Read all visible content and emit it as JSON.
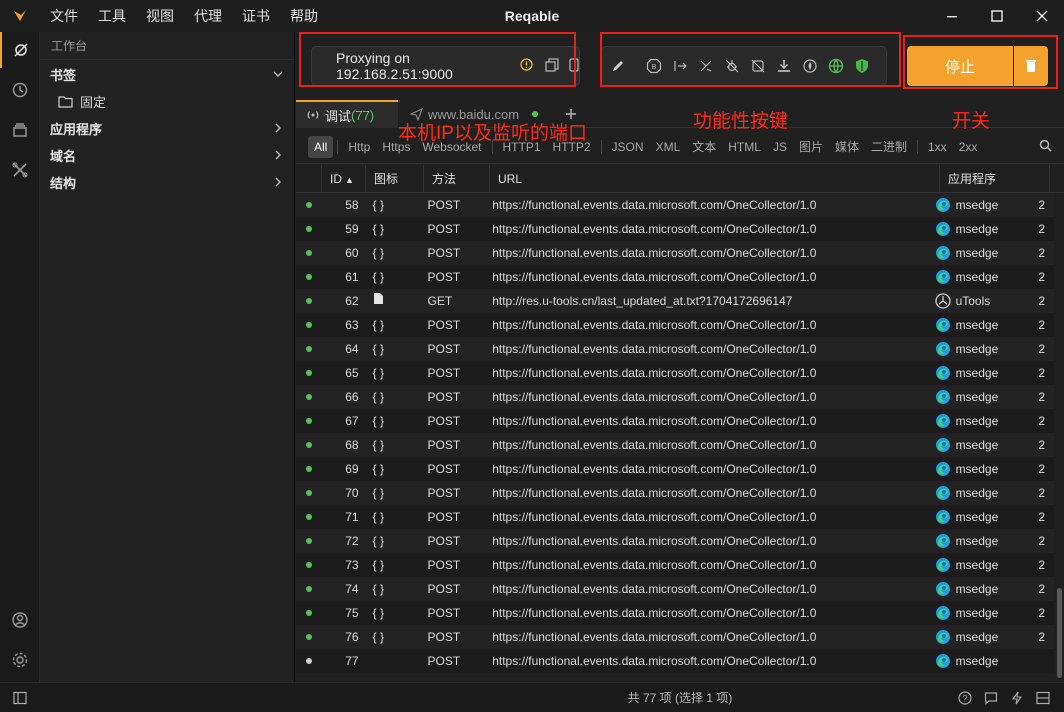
{
  "titlebar": {
    "title": "Reqable",
    "menus": [
      "文件",
      "工具",
      "视图",
      "代理",
      "证书",
      "帮助"
    ]
  },
  "sidebar": {
    "header": "工作台",
    "bookmarks": "书签",
    "pinned": "固定",
    "apps": "应用程序",
    "domains": "域名",
    "structure": "结构"
  },
  "toolbar": {
    "proxy_text": "Proxying on 192.168.2.51:9000",
    "stop_label": "停止"
  },
  "annotations": {
    "ip_port": "本机IP以及监听的端口",
    "function_keys": "功能性按键",
    "switch": "开关"
  },
  "tabs": [
    {
      "label": "调试",
      "count": "(77)"
    },
    {
      "label": "www.baidu.com"
    }
  ],
  "filters": [
    "All",
    "Http",
    "Https",
    "Websocket",
    "HTTP1",
    "HTTP2",
    "JSON",
    "XML",
    "文本",
    "HTML",
    "JS",
    "图片",
    "媒体",
    "二进制",
    "1xx",
    "2xx"
  ],
  "table": {
    "headers": {
      "id": "ID",
      "icon": "图标",
      "method": "方法",
      "url": "URL",
      "app": "应用程序"
    },
    "rows": [
      {
        "id": "58",
        "icon": "{ }",
        "method": "POST",
        "url": "https://functional.events.data.microsoft.com/OneCollector/1.0",
        "app": "msedge",
        "status": "done",
        "more": "2"
      },
      {
        "id": "59",
        "icon": "{ }",
        "method": "POST",
        "url": "https://functional.events.data.microsoft.com/OneCollector/1.0",
        "app": "msedge",
        "status": "done",
        "more": "2"
      },
      {
        "id": "60",
        "icon": "{ }",
        "method": "POST",
        "url": "https://functional.events.data.microsoft.com/OneCollector/1.0",
        "app": "msedge",
        "status": "done",
        "more": "2"
      },
      {
        "id": "61",
        "icon": "{ }",
        "method": "POST",
        "url": "https://functional.events.data.microsoft.com/OneCollector/1.0",
        "app": "msedge",
        "status": "done",
        "more": "2"
      },
      {
        "id": "62",
        "icon": "file",
        "method": "GET",
        "url": "http://res.u-tools.cn/last_updated_at.txt?1704172696147",
        "app": "uTools",
        "status": "done",
        "more": "2"
      },
      {
        "id": "63",
        "icon": "{ }",
        "method": "POST",
        "url": "https://functional.events.data.microsoft.com/OneCollector/1.0",
        "app": "msedge",
        "status": "done",
        "more": "2"
      },
      {
        "id": "64",
        "icon": "{ }",
        "method": "POST",
        "url": "https://functional.events.data.microsoft.com/OneCollector/1.0",
        "app": "msedge",
        "status": "done",
        "more": "2"
      },
      {
        "id": "65",
        "icon": "{ }",
        "method": "POST",
        "url": "https://functional.events.data.microsoft.com/OneCollector/1.0",
        "app": "msedge",
        "status": "done",
        "more": "2"
      },
      {
        "id": "66",
        "icon": "{ }",
        "method": "POST",
        "url": "https://functional.events.data.microsoft.com/OneCollector/1.0",
        "app": "msedge",
        "status": "done",
        "more": "2"
      },
      {
        "id": "67",
        "icon": "{ }",
        "method": "POST",
        "url": "https://functional.events.data.microsoft.com/OneCollector/1.0",
        "app": "msedge",
        "status": "done",
        "more": "2"
      },
      {
        "id": "68",
        "icon": "{ }",
        "method": "POST",
        "url": "https://functional.events.data.microsoft.com/OneCollector/1.0",
        "app": "msedge",
        "status": "done",
        "more": "2"
      },
      {
        "id": "69",
        "icon": "{ }",
        "method": "POST",
        "url": "https://functional.events.data.microsoft.com/OneCollector/1.0",
        "app": "msedge",
        "status": "done",
        "more": "2"
      },
      {
        "id": "70",
        "icon": "{ }",
        "method": "POST",
        "url": "https://functional.events.data.microsoft.com/OneCollector/1.0",
        "app": "msedge",
        "status": "done",
        "more": "2"
      },
      {
        "id": "71",
        "icon": "{ }",
        "method": "POST",
        "url": "https://functional.events.data.microsoft.com/OneCollector/1.0",
        "app": "msedge",
        "status": "done",
        "more": "2"
      },
      {
        "id": "72",
        "icon": "{ }",
        "method": "POST",
        "url": "https://functional.events.data.microsoft.com/OneCollector/1.0",
        "app": "msedge",
        "status": "done",
        "more": "2"
      },
      {
        "id": "73",
        "icon": "{ }",
        "method": "POST",
        "url": "https://functional.events.data.microsoft.com/OneCollector/1.0",
        "app": "msedge",
        "status": "done",
        "more": "2"
      },
      {
        "id": "74",
        "icon": "{ }",
        "method": "POST",
        "url": "https://functional.events.data.microsoft.com/OneCollector/1.0",
        "app": "msedge",
        "status": "done",
        "more": "2"
      },
      {
        "id": "75",
        "icon": "{ }",
        "method": "POST",
        "url": "https://functional.events.data.microsoft.com/OneCollector/1.0",
        "app": "msedge",
        "status": "done",
        "more": "2"
      },
      {
        "id": "76",
        "icon": "{ }",
        "method": "POST",
        "url": "https://functional.events.data.microsoft.com/OneCollector/1.0",
        "app": "msedge",
        "status": "done",
        "more": "2"
      },
      {
        "id": "77",
        "icon": "",
        "method": "POST",
        "url": "https://functional.events.data.microsoft.com/OneCollector/1.0",
        "app": "msedge",
        "status": "pending",
        "more": ""
      }
    ]
  },
  "status": {
    "summary": "共 77 项 (选择 1 项)"
  },
  "colors": {
    "accent": "#f2a22d",
    "annotation": "#e8201e",
    "success_dot": "#56c256"
  }
}
